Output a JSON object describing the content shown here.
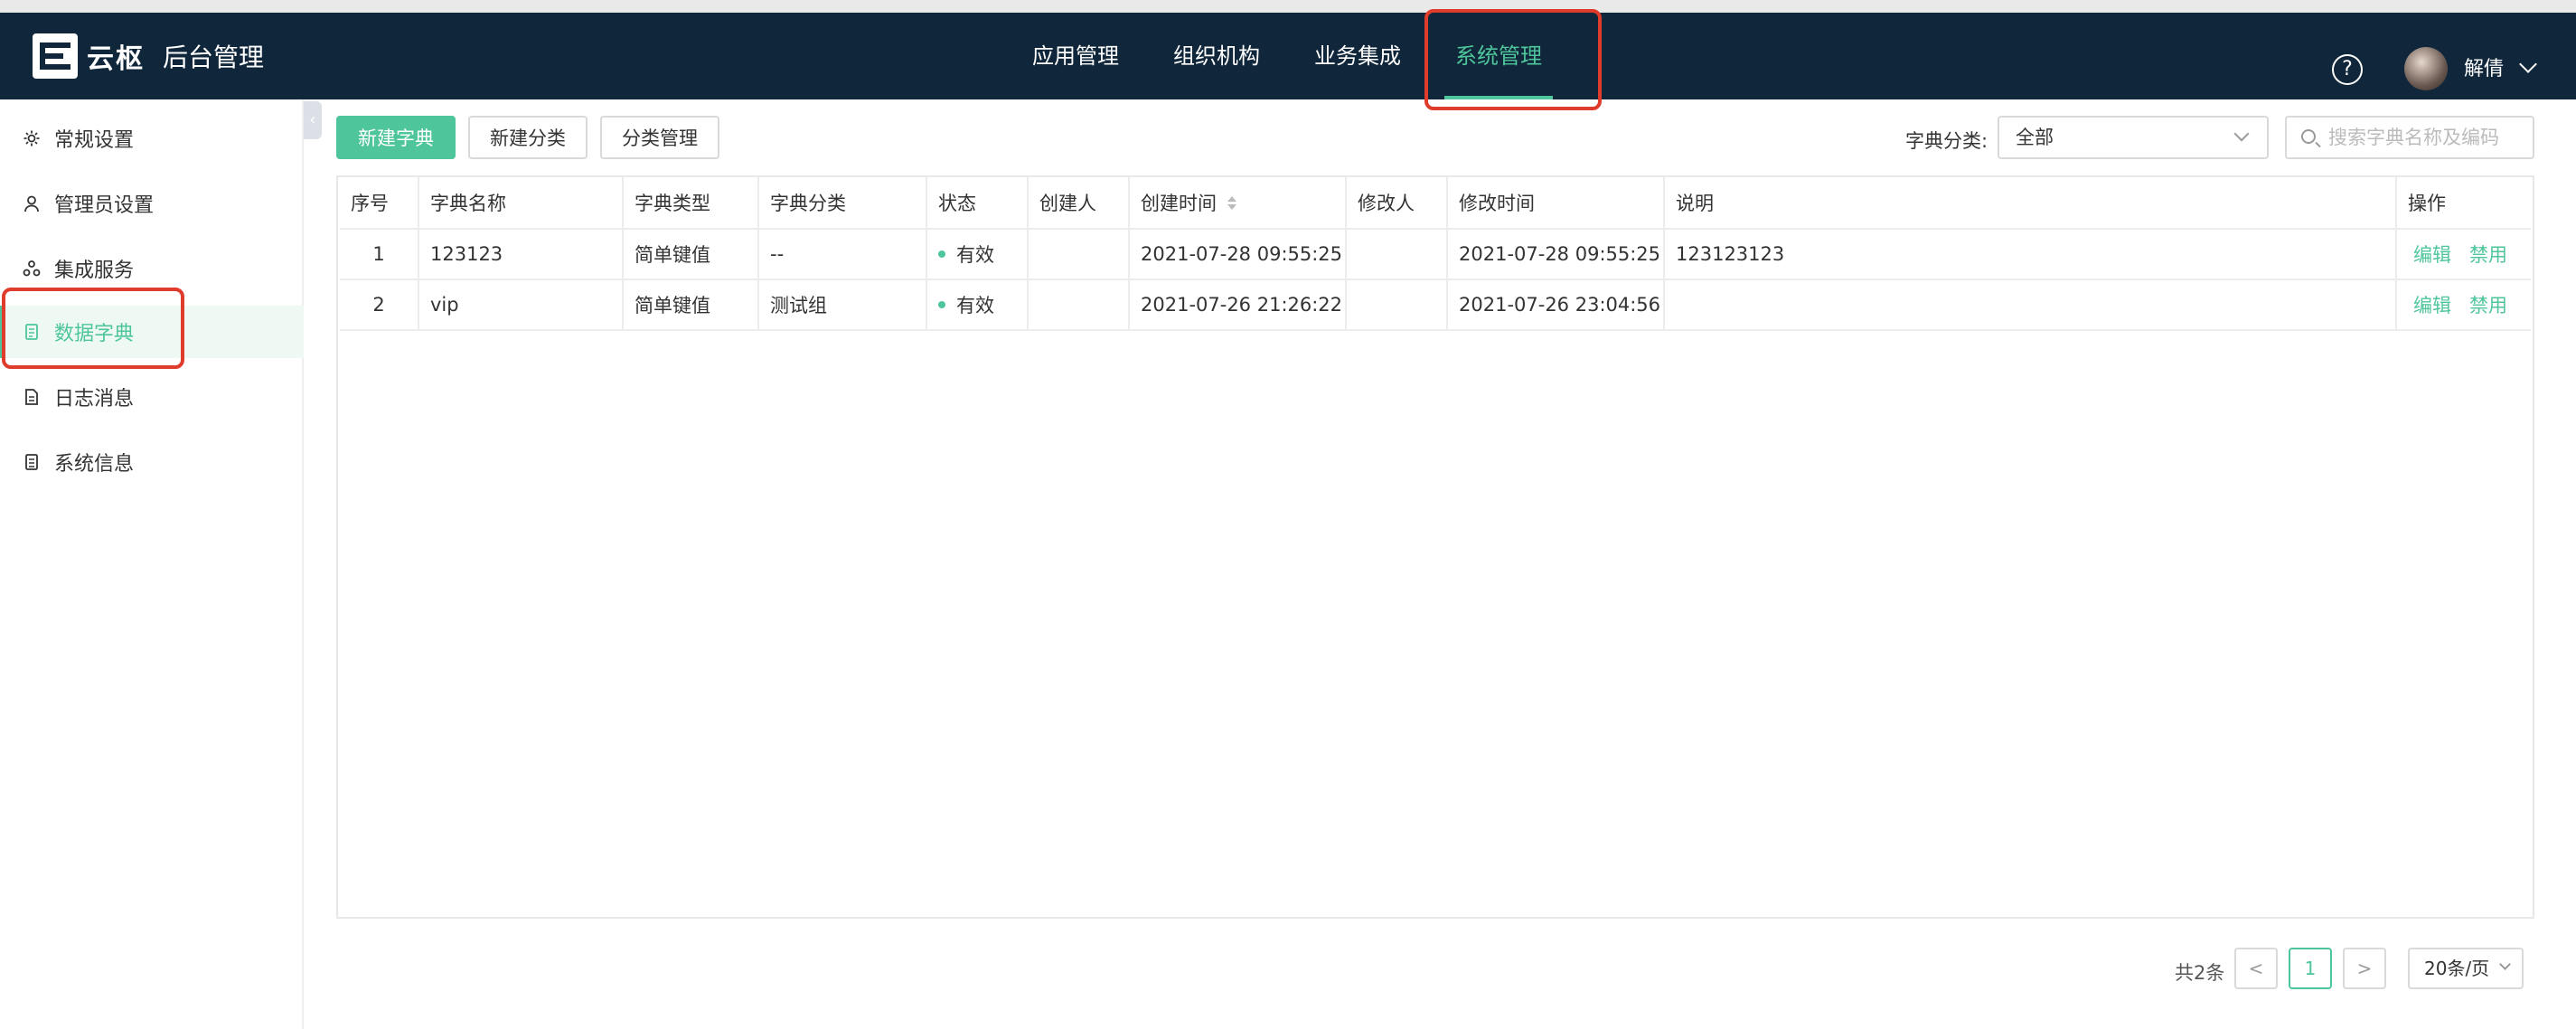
{
  "header": {
    "logo_text": "云枢",
    "title": "后台管理",
    "nav": [
      "应用管理",
      "组织机构",
      "业务集成",
      "系统管理"
    ],
    "active_nav": "系统管理",
    "help_glyph": "?",
    "user_name": "解倩",
    "accent_color": "#4fc59b",
    "bg_color": "#10263a"
  },
  "sidebar": {
    "items": [
      {
        "label": "常规设置",
        "icon": "gear-icon"
      },
      {
        "label": "管理员设置",
        "icon": "user-icon"
      },
      {
        "label": "集成服务",
        "icon": "cluster-icon"
      },
      {
        "label": "数据字典",
        "icon": "dictionary-icon"
      },
      {
        "label": "日志消息",
        "icon": "log-icon"
      },
      {
        "label": "系统信息",
        "icon": "info-doc-icon"
      }
    ],
    "active": "数据字典",
    "collapse_glyph": "‹"
  },
  "toolbar": {
    "new_dict": "新建字典",
    "new_category": "新建分类",
    "manage_category": "分类管理",
    "filter_label": "字典分类:",
    "filter_value": "全部",
    "search_placeholder": "搜索字典名称及编码"
  },
  "table": {
    "columns": [
      "序号",
      "字典名称",
      "字典类型",
      "字典分类",
      "状态",
      "创建人",
      "创建时间",
      "修改人",
      "修改时间",
      "说明",
      "操作"
    ],
    "rows": [
      {
        "index": "1",
        "name": "123123",
        "type": "简单键值",
        "category": "--",
        "status": "有效",
        "creator": "",
        "created": "2021-07-28 09:55:25",
        "modifier": "",
        "modified": "2021-07-28 09:55:25",
        "desc": "123123123",
        "edit": "编辑",
        "disable": "禁用"
      },
      {
        "index": "2",
        "name": "vip",
        "type": "简单键值",
        "category": "测试组",
        "status": "有效",
        "creator": "",
        "created": "2021-07-26 21:26:22",
        "modifier": "",
        "modified": "2021-07-26 23:04:56",
        "desc": "",
        "edit": "编辑",
        "disable": "禁用"
      }
    ]
  },
  "pagination": {
    "total": "共2条",
    "prev_glyph": "<",
    "current": "1",
    "next_glyph": ">",
    "page_size": "20条/页"
  }
}
